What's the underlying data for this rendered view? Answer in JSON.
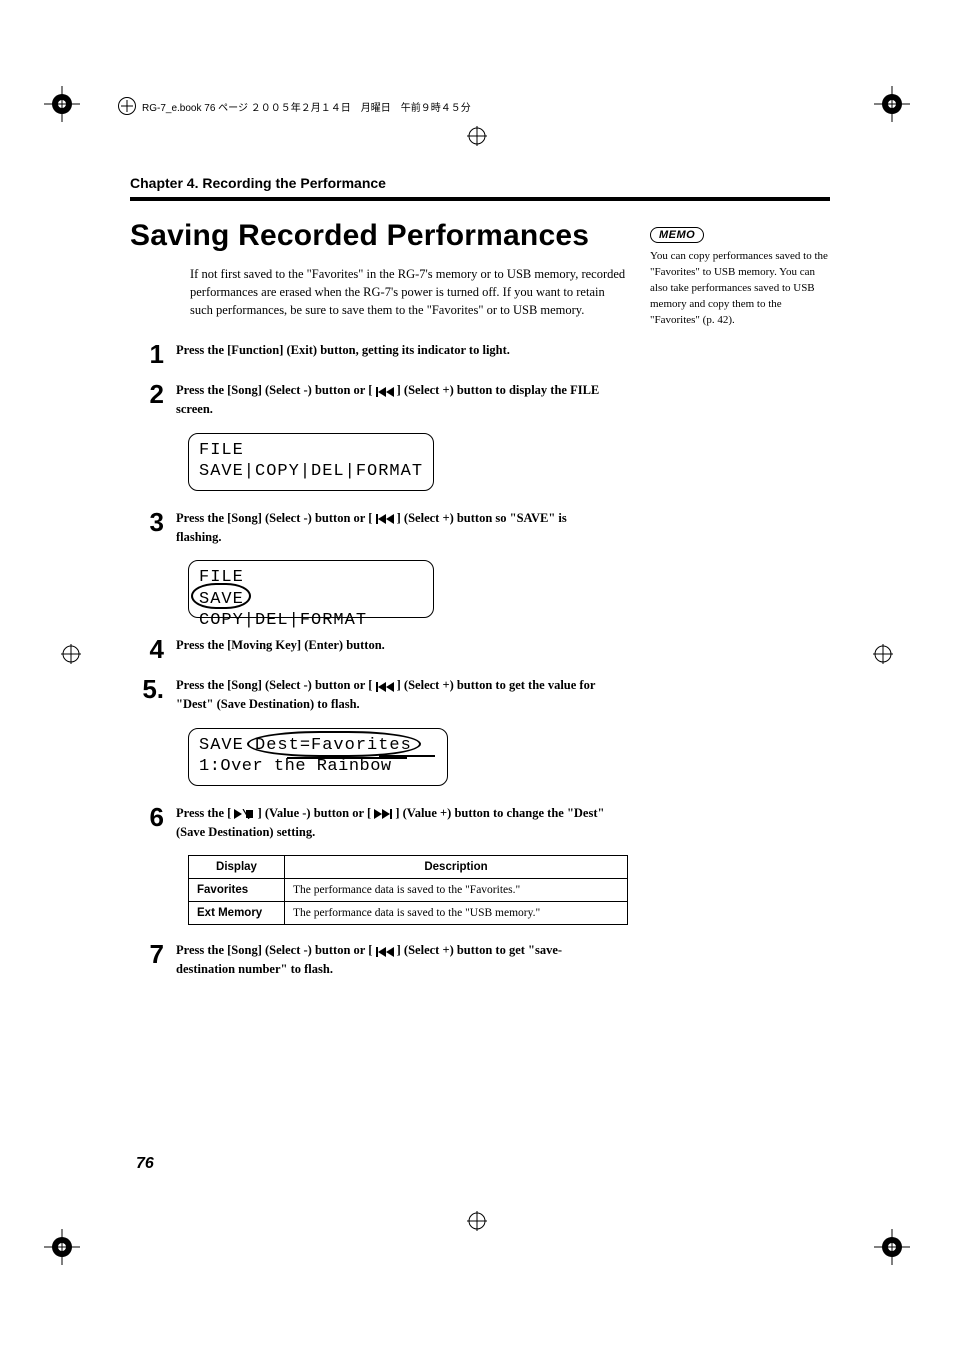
{
  "bookline": "RG-7_e.book  76 ページ  ２００５年２月１４日　月曜日　午前９時４５分",
  "chapter": "Chapter 4. Recording the Performance",
  "title": "Saving Recorded Performances",
  "intro": "If not first saved to the \"Favorites\" in the RG-7's memory or to USB memory, recorded performances are erased when the RG-7's power is turned off. If you want to retain such performances, be sure to save them to the \"Favorites\" or to USB memory.",
  "steps": {
    "s1": {
      "num": "1",
      "text": "Press the [Function] (Exit) button, getting its indicator to light."
    },
    "s2": {
      "num": "2",
      "pre": "Press the [Song] (Select -) button or [ ",
      "post": " ] (Select +) button to display the FILE screen."
    },
    "s3": {
      "num": "3",
      "pre": "Press the [Song] (Select -) button or [ ",
      "post": " ] (Select +) button so \"SAVE\" is flashing."
    },
    "s4": {
      "num": "4",
      "text": "Press the [Moving Key] (Enter) button."
    },
    "s5": {
      "num": "5.",
      "pre": "Press the [Song] (Select -) button or [ ",
      "post": " ] (Select +) button to get the value for \"Dest\" (Save Destination) to flash."
    },
    "s6": {
      "num": "6",
      "pre": "Press the [ ",
      "mid": " ] (Value -) button or [ ",
      "post": " ] (Value +) button to change the \"Dest\" (Save Destination) setting."
    },
    "s7": {
      "num": "7",
      "pre": "Press the [Song] (Select -) button or [ ",
      "post": " ] (Select +) button to get \"save-destination number\" to flash."
    }
  },
  "lcd": {
    "file1_l1": "FILE",
    "file1_l2": "SAVE|COPY|DEL|FORMAT",
    "file2_l1": "FILE",
    "file2_l2": "SAVE COPY|DEL|FORMAT",
    "save_l1": "SAVE  Dest=Favorites",
    "save_l2": "  1:Over the Rainbow"
  },
  "table": {
    "h1": "Display",
    "h2": "Description",
    "r1c1": "Favorites",
    "r1c2": "The performance data is saved to the \"Favorites.\"",
    "r2c1": "Ext Memory",
    "r2c2": "The performance data is saved to the \"USB memory.\""
  },
  "memo": {
    "label": "MEMO",
    "text": "You can copy performances saved to the \"Favorites\" to USB memory. You can also take performances saved to USB memory and copy them to the \"Favorites\" (p. 42)."
  },
  "pagenum": "76"
}
